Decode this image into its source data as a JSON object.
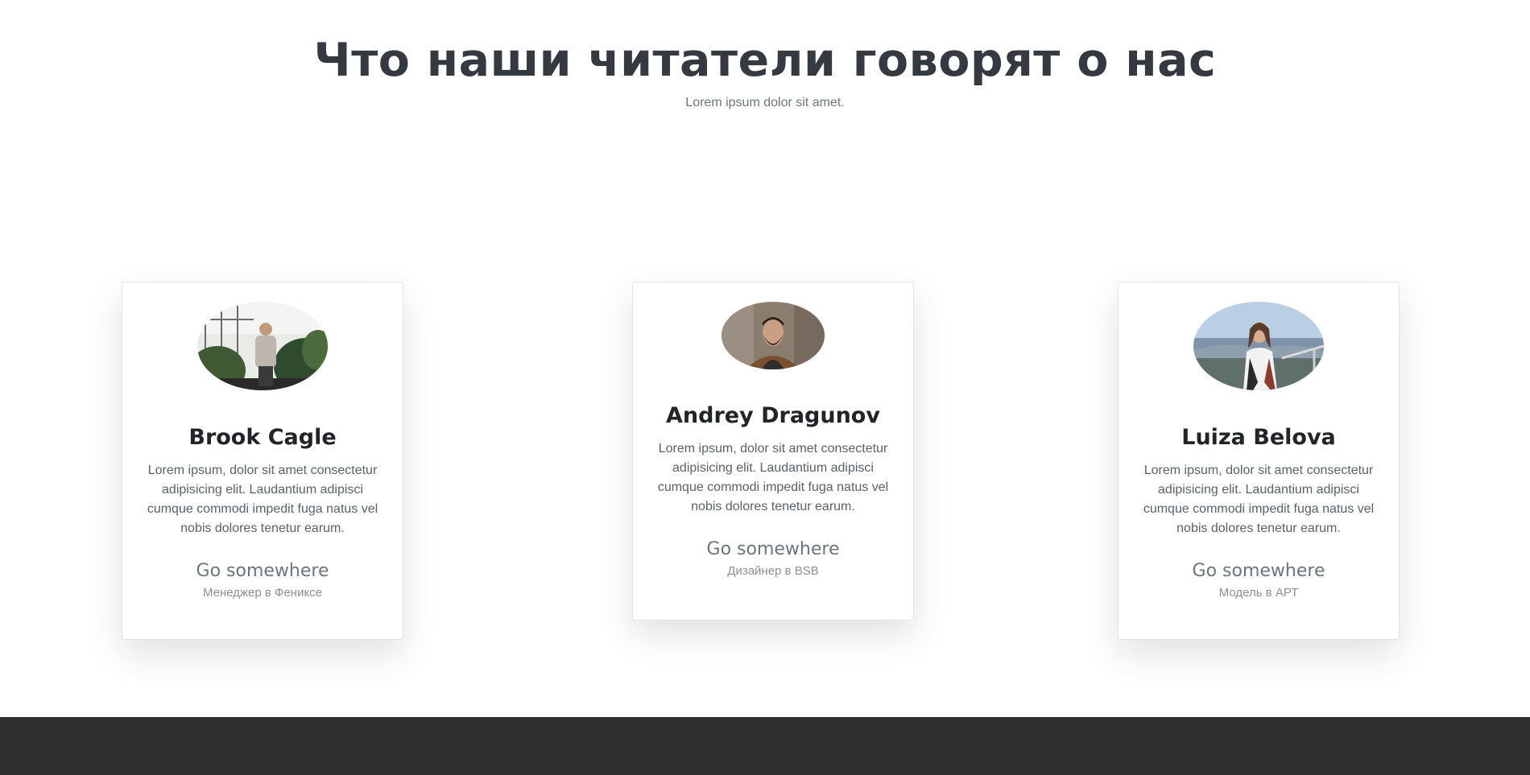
{
  "section": {
    "title": "Что наши читатели говорят о нас",
    "subtitle": "Lorem ipsum dolor sit amet."
  },
  "testimonials": [
    {
      "name": "Brook Cagle",
      "text": "Lorem ipsum, dolor sit amet consectetur adipisicing elit. Laudantium adipisci cumque commodi impedit fuga natus vel nobis dolores tenetur earum.",
      "link_label": "Go somewhere",
      "role": "Менеджер в Фениксе",
      "avatar_icon": "man-with-plants-photo"
    },
    {
      "name": "Andrey Dragunov",
      "text": "Lorem ipsum, dolor sit amet consectetur adipisicing elit. Laudantium adipisci cumque commodi impedit fuga natus vel nobis dolores tenetur earum.",
      "link_label": "Go somewhere",
      "role": "Дизайнер в BSB",
      "avatar_icon": "bearded-man-photo"
    },
    {
      "name": "Luiza Belova",
      "text": "Lorem ipsum, dolor sit amet consectetur adipisicing elit. Laudantium adipisci cumque commodi impedit fuga natus vel nobis dolores tenetur earum.",
      "link_label": "Go somewhere",
      "role": "Модель в АРТ",
      "avatar_icon": "woman-on-balcony-photo"
    }
  ],
  "colors": {
    "heading": "#343a40",
    "muted": "#6c757d",
    "footer": "#2f2f2f"
  }
}
